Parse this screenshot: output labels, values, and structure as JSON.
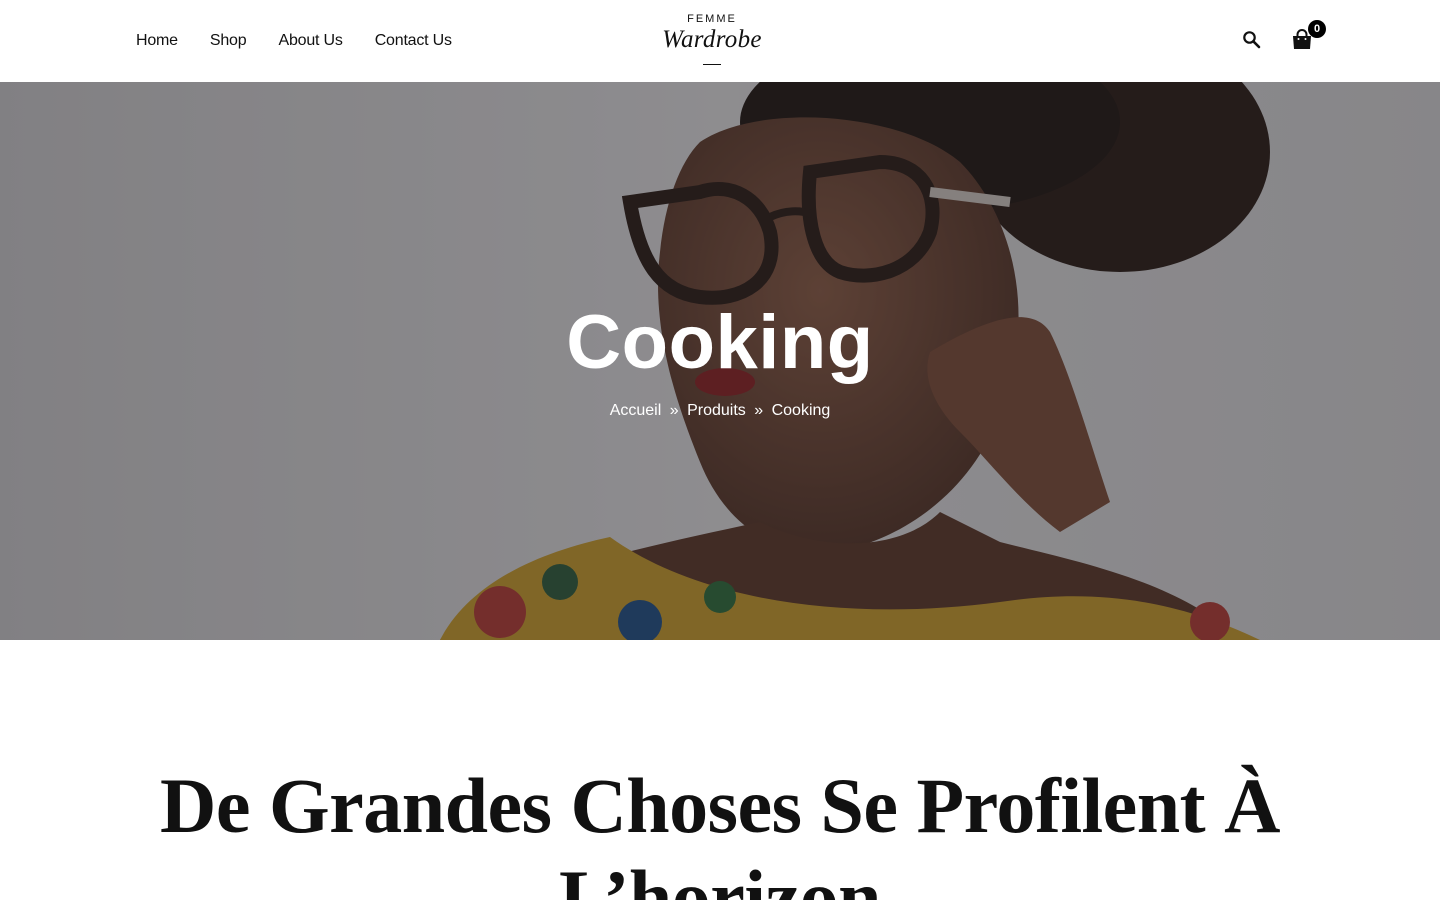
{
  "header": {
    "nav": [
      "Home",
      "Shop",
      "About Us",
      "Contact Us"
    ],
    "logo_top": "FEMME",
    "logo_main": "Wardrobe",
    "cart_count": "0",
    "icons": {
      "search": "search-icon",
      "cart": "shopping-bag-icon"
    }
  },
  "hero": {
    "title": "Cooking",
    "breadcrumb": {
      "home": "Accueil",
      "sep": "»",
      "products": "Produits",
      "current": "Cooking"
    }
  },
  "section": {
    "heading": "De Grandes Choses Se Profilent À L’horizon"
  },
  "colors": {
    "text": "#111111",
    "background": "#ffffff",
    "hero_overlay": "#1e1e22"
  }
}
